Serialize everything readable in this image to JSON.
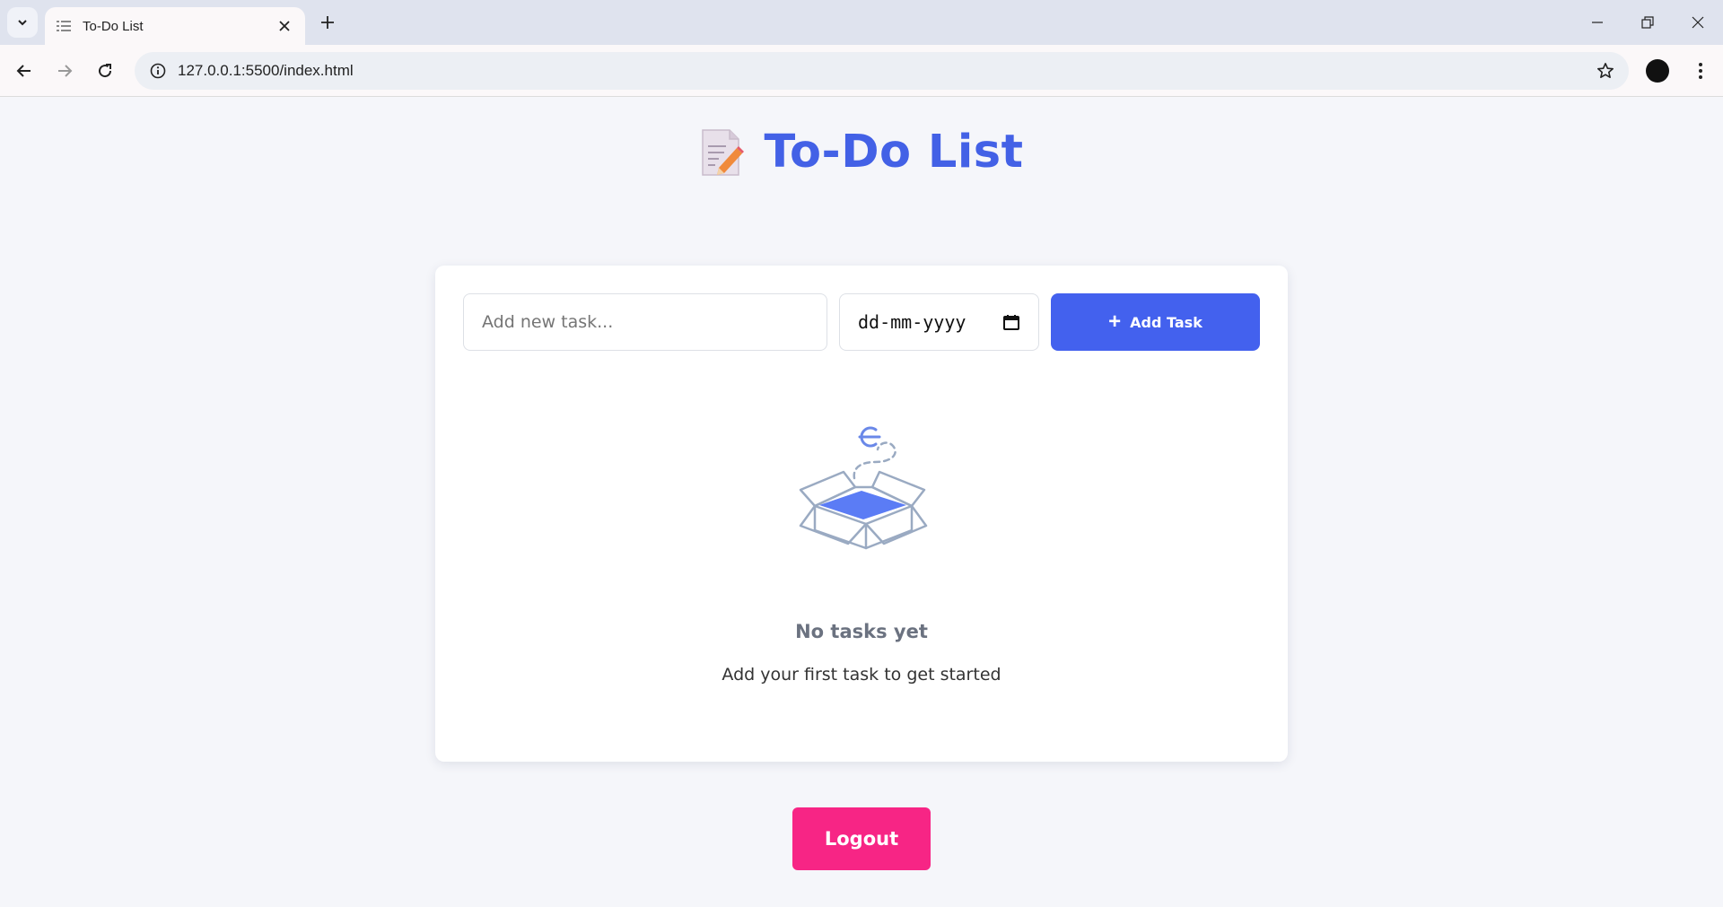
{
  "browser": {
    "tab_title": "To-Do List",
    "url": "127.0.0.1:5500/index.html"
  },
  "page": {
    "title": "To-Do List",
    "title_emoji": "memo-icon"
  },
  "form": {
    "task_placeholder": "Add new task...",
    "date_value": "dd-mm-yyyy",
    "add_button_label": "Add Task"
  },
  "empty_state": {
    "title": "No tasks yet",
    "subtitle": "Add your first task to get started"
  },
  "logout_label": "Logout",
  "colors": {
    "accent": "#4361ee",
    "logout": "#f72585",
    "background": "#f5f6fa"
  }
}
